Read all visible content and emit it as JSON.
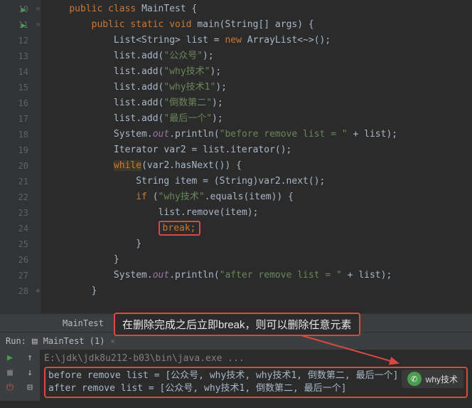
{
  "gutter": {
    "start": 10,
    "end": 28,
    "run_icons": [
      10,
      11
    ],
    "fold_open": [
      10,
      11
    ],
    "fold_close": [
      28
    ]
  },
  "code": {
    "l10": {
      "indent": "    ",
      "t1": "public class ",
      "t2": "MainTest {"
    },
    "l11": {
      "indent": "        ",
      "t1": "public static void ",
      "t2": "main",
      "t3": "(String[] args) {"
    },
    "l12": {
      "indent": "            ",
      "t1": "List<String> list = ",
      "t2": "new ",
      "t3": "ArrayList<~>();"
    },
    "l13": {
      "indent": "            ",
      "t1": "list.add(",
      "s": "\"公众号\"",
      "t2": ");"
    },
    "l14": {
      "indent": "            ",
      "t1": "list.add(",
      "s": "\"why技术\"",
      "t2": ");"
    },
    "l15": {
      "indent": "            ",
      "t1": "list.add(",
      "s": "\"why技术1\"",
      "t2": ");"
    },
    "l16": {
      "indent": "            ",
      "t1": "list.add(",
      "s": "\"倒数第二\"",
      "t2": ");"
    },
    "l17": {
      "indent": "            ",
      "t1": "list.add(",
      "s": "\"最后一个\"",
      "t2": ");"
    },
    "l18": {
      "indent": "            ",
      "t1": "System.",
      "f": "out",
      "t2": ".println(",
      "s": "\"before remove list = \"",
      "t3": " + list);"
    },
    "l19": {
      "indent": "            ",
      "t1": "Iterator var2 = list.iterator();"
    },
    "l20": {
      "indent": "            ",
      "kw": "while",
      "t1": "(var2.hasNext()) {"
    },
    "l21": {
      "indent": "                ",
      "t1": "String item = (String)var2.next();"
    },
    "l22": {
      "indent": "                ",
      "kw": "if ",
      "t1": "(",
      "s": "\"why技术\"",
      "t2": ".equals(item)) {"
    },
    "l23": {
      "indent": "                    ",
      "t1": "list.remove(item);"
    },
    "l24": {
      "indent": "                    ",
      "kw": "break;"
    },
    "l25": {
      "indent": "                ",
      "t1": "}"
    },
    "l26": {
      "indent": "            ",
      "t1": "}"
    },
    "l27": {
      "indent": "            ",
      "t1": "System.",
      "f": "out",
      "t2": ".println(",
      "s": "\"after remove list = \"",
      "t3": " + list);"
    },
    "l28": {
      "indent": "        ",
      "t1": "}"
    }
  },
  "tab": "MainTest",
  "annotation": "在删除完成之后立即break，则可以删除任意元素",
  "run": {
    "label": "Run:",
    "config": "MainTest (1)",
    "cmd": "E:\\jdk\\jdk8u212-b03\\bin\\java.exe ...",
    "out1": "before remove list = [公众号, why技术, why技术1, 倒数第二, 最后一个]",
    "out2": "after remove list = [公众号, why技术1, 倒数第二, 最后一个]"
  },
  "watermark": "why技术"
}
